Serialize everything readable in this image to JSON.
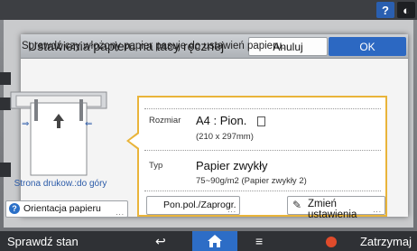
{
  "dialog": {
    "title": "Ustawienia papieru na tacy ręcznej",
    "cancel_label": "Anuluj",
    "ok_label": "OK",
    "message": "Sprawdź czy włożony papier pasuje do ustawień papieru."
  },
  "tray": {
    "face_label": "Strona drukow.:do góry",
    "orientation_button": "Orientacja papieru"
  },
  "settings": {
    "size_label": "Rozmiar",
    "size_value": "A4 : Pion.",
    "size_dims": "(210 x 297mm)",
    "type_label": "Typ",
    "type_value": "Papier zwykły",
    "type_detail": "75~90g/m2 (Papier zwykły 2)",
    "position_button": "Pon.pol./Zaprogr.",
    "change_button": "Zmień ustawienia"
  },
  "bottom_bar": {
    "check_status": "Sprawdź stan",
    "stop": "Zatrzymaj"
  },
  "top_icons": [
    "?",
    "◐"
  ],
  "colors": {
    "accent": "#2c68c2",
    "highlight": "#e9b43a",
    "stop": "#e04b2b"
  }
}
